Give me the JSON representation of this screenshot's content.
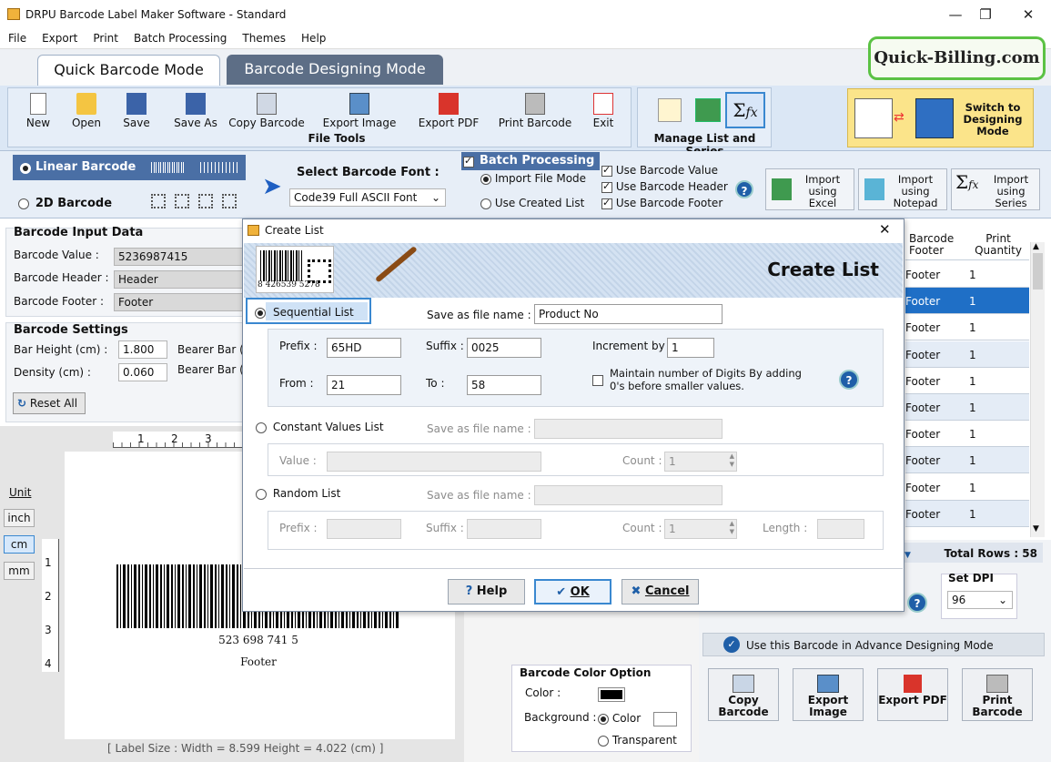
{
  "window": {
    "title": "DRPU Barcode Label Maker Software - Standard"
  },
  "menu": [
    "File",
    "Export",
    "Print",
    "Batch Processing",
    "Themes",
    "Help"
  ],
  "modes": {
    "quick": "Quick Barcode Mode",
    "designing": "Barcode Designing Mode"
  },
  "brand": "Quick-Billing.com",
  "toolbar": {
    "file_tools": [
      "New",
      "Open",
      "Save",
      "Save As",
      "Copy Barcode",
      "Export Image",
      "Export PDF",
      "Print Barcode",
      "Exit"
    ],
    "file_tools_label": "File Tools",
    "manage_label": "Manage List and Series",
    "switch_label": "Switch to Designing Mode"
  },
  "barcode_type": {
    "linear": "Linear Barcode",
    "twod": "2D Barcode"
  },
  "font": {
    "label": "Select Barcode Font :",
    "value": "Code39 Full ASCII Font"
  },
  "batch": {
    "title": "Batch Processing",
    "import_file": "Import File Mode",
    "use_created": "Use Created List",
    "use_value": "Use Barcode Value",
    "use_header": "Use Barcode Header",
    "use_footer": "Use Barcode Footer",
    "import_excel": "Import using Excel",
    "import_notepad": "Import using Notepad",
    "import_series": "Import using Series"
  },
  "input": {
    "title": "Barcode Input Data",
    "value_label": "Barcode Value :",
    "value": "5236987415",
    "header_label": "Barcode Header :",
    "header": "Header",
    "footer_label": "Barcode Footer :",
    "footer": "Footer"
  },
  "settings": {
    "title": "Barcode Settings",
    "bar_height_label": "Bar Height (cm) :",
    "bar_height": "1.800",
    "density_label": "Density (cm) :",
    "density": "0.060",
    "bearer1": "Bearer Bar (",
    "bearer2": "Bearer Bar (",
    "reset": "Reset All"
  },
  "units": {
    "label": "Unit",
    "items": [
      "inch",
      "cm",
      "mm"
    ]
  },
  "ruler_top": [
    "1",
    "2",
    "3"
  ],
  "ruler_left": [
    "1",
    "2",
    "3",
    "4"
  ],
  "preview": {
    "number": "523 698 741 5",
    "footer": "Footer"
  },
  "label_size": "[ Label Size : Width = 8.599  Height = 4.022 (cm) ]",
  "grid": {
    "col_footer": "Barcode Footer",
    "col_qty": "Print Quantity",
    "rows": [
      {
        "footer": "Footer",
        "qty": "1"
      },
      {
        "footer": "Footer",
        "qty": "1"
      },
      {
        "footer": "Footer",
        "qty": "1"
      },
      {
        "footer": "Footer",
        "qty": "1"
      },
      {
        "footer": "Footer",
        "qty": "1"
      },
      {
        "footer": "Footer",
        "qty": "1"
      },
      {
        "footer": "Footer",
        "qty": "1"
      },
      {
        "footer": "Footer",
        "qty": "1"
      },
      {
        "footer": "Footer",
        "qty": "1"
      },
      {
        "footer": "Footer",
        "qty": "1"
      }
    ],
    "total_rows": "Total Rows : 58"
  },
  "dpi": {
    "label": "Set DPI",
    "value": "96"
  },
  "advance": "Use this Barcode in Advance Designing Mode",
  "actions": [
    "Copy Barcode",
    "Export Image",
    "Export PDF",
    "Print Barcode"
  ],
  "color_option": {
    "title": "Barcode Color Option",
    "color_label": "Color :",
    "bg_label": "Background :",
    "bg_color": "Color",
    "bg_transparent": "Transparent"
  },
  "dialog": {
    "title": "Create List",
    "header": "Create List",
    "sample_digits": "8  426539  5278",
    "sequential": {
      "label": "Sequential List",
      "save_label": "Save as file name :",
      "save_value": "Product No",
      "prefix_label": "Prefix :",
      "prefix": "65HD",
      "suffix_label": "Suffix :",
      "suffix": "0025",
      "increment_label": "Increment by :",
      "increment": "1",
      "from_label": "From :",
      "from": "21",
      "to_label": "To :",
      "to": "58",
      "maintain": "Maintain number of Digits By adding 0's before smaller values."
    },
    "constant": {
      "label": "Constant Values List",
      "save_label": "Save as file name :",
      "value_label": "Value :",
      "count_label": "Count :",
      "count": "1"
    },
    "random": {
      "label": "Random List",
      "save_label": "Save as file name :",
      "prefix_label": "Prefix :",
      "suffix_label": "Suffix :",
      "count_label": "Count :",
      "count": "1",
      "length_label": "Length :"
    },
    "help": "Help",
    "ok": "OK",
    "cancel": "Cancel"
  }
}
